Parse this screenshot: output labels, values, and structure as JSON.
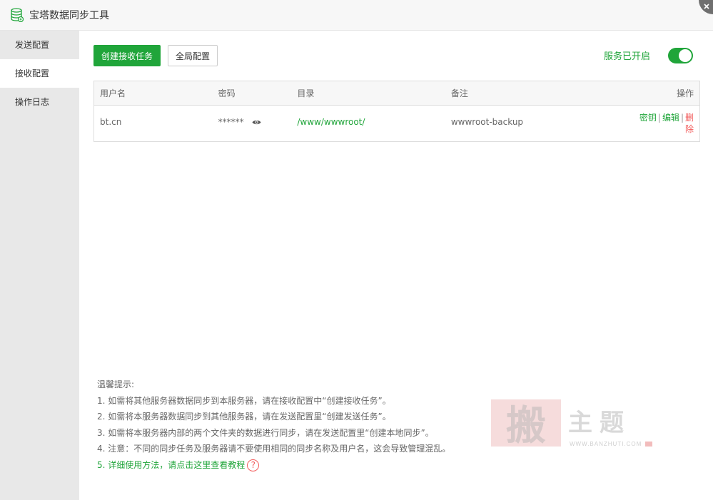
{
  "window": {
    "title": "宝塔数据同步工具"
  },
  "sidebar": {
    "items": [
      {
        "label": "发送配置"
      },
      {
        "label": "接收配置"
      },
      {
        "label": "操作日志"
      }
    ]
  },
  "toolbar": {
    "create_label": "创建接收任务",
    "global_label": "全局配置",
    "service_status": "服务已开启",
    "service_enabled": true
  },
  "table": {
    "headers": [
      "用户名",
      "密码",
      "目录",
      "备注",
      "操作"
    ],
    "rows": [
      {
        "username": "bt.cn",
        "password": "******",
        "directory": "/www/wwwroot/",
        "note": "wwwroot-backup",
        "actions": [
          "密钥",
          "编辑",
          "删除"
        ],
        "separator": "|"
      }
    ]
  },
  "tips": {
    "heading": "温馨提示:",
    "items": [
      "1. 如需将其他服务器数据同步到本服务器，请在接收配置中“创建接收任务”。",
      "2. 如需将本服务器数据同步到其他服务器，请在发送配置里“创建发送任务”。",
      "3. 如需将本服务器内部的两个文件夹的数据进行同步，请在发送配置里“创建本地同步”。",
      "4. 注意：不同的同步任务及服务器请不要使用相同的同步名称及用户名，这会导致管理混乱。"
    ],
    "item5_prefix": "5.",
    "item5_link": "详细使用方法，请点击这里查看教程",
    "help_icon_glyph": "?"
  },
  "watermark": {
    "char": "搬",
    "title": "主题",
    "url": "WWW.BANZHUTI.COM"
  },
  "colors": {
    "accent": "#20a53a",
    "danger": "#f25c5c",
    "sidebar_bg": "#e8e8e8"
  },
  "icons": [
    "database-icon",
    "close-icon",
    "eye-icon",
    "help-circle-icon"
  ]
}
